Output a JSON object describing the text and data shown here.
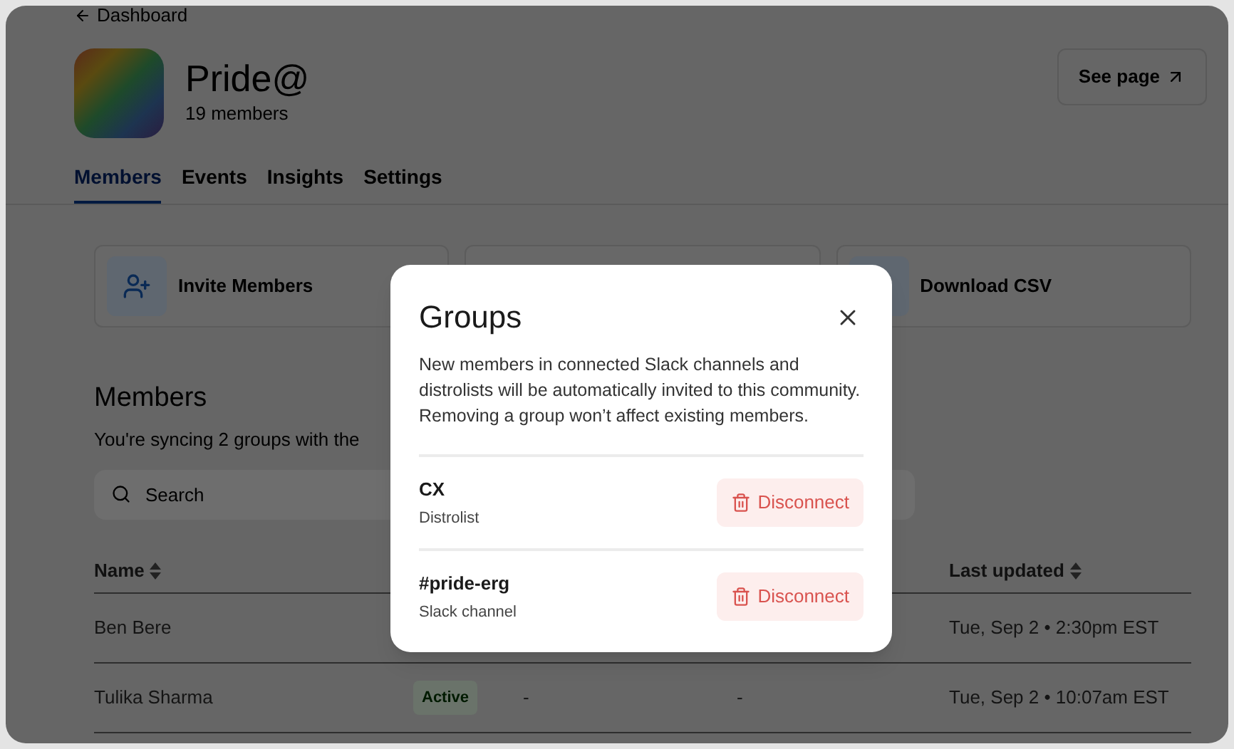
{
  "back_link": {
    "label": "Dashboard"
  },
  "community": {
    "name": "Pride@",
    "member_count": "19 members"
  },
  "see_page_button": {
    "label": "See page"
  },
  "tabs": [
    {
      "label": "Members",
      "selected": true
    },
    {
      "label": "Events",
      "selected": false
    },
    {
      "label": "Insights",
      "selected": false
    },
    {
      "label": "Settings",
      "selected": false
    }
  ],
  "actions": [
    {
      "label": "Invite Members",
      "kind": "invite"
    },
    {
      "kind": "hidden"
    },
    {
      "label": "Download CSV",
      "kind": "download"
    }
  ],
  "members_section": {
    "title": "Members",
    "subtitle": "You're syncing 2 groups with the"
  },
  "search": {
    "placeholder": "Search"
  },
  "table": {
    "name_column": "Name",
    "last_updated_column": "Last updated",
    "rows": [
      {
        "name": "Ben Bere",
        "last_updated": "Tue, Sep 2 • 2:30pm EST"
      },
      {
        "name": "Tulika Sharma",
        "status": "Active",
        "column_3": "-",
        "column_4": "-",
        "last_updated": "Tue, Sep 2 • 10:07am EST"
      }
    ]
  },
  "modal": {
    "title": "Groups",
    "description": "New members in connected Slack channels and distrolists will be automatically invited to this community. Removing a group won’t affect existing members.",
    "groups": [
      {
        "name": "CX",
        "type": "Distrolist",
        "action": "Disconnect"
      },
      {
        "name": "#pride-erg",
        "type": "Slack channel",
        "action": "Disconnect"
      }
    ]
  }
}
